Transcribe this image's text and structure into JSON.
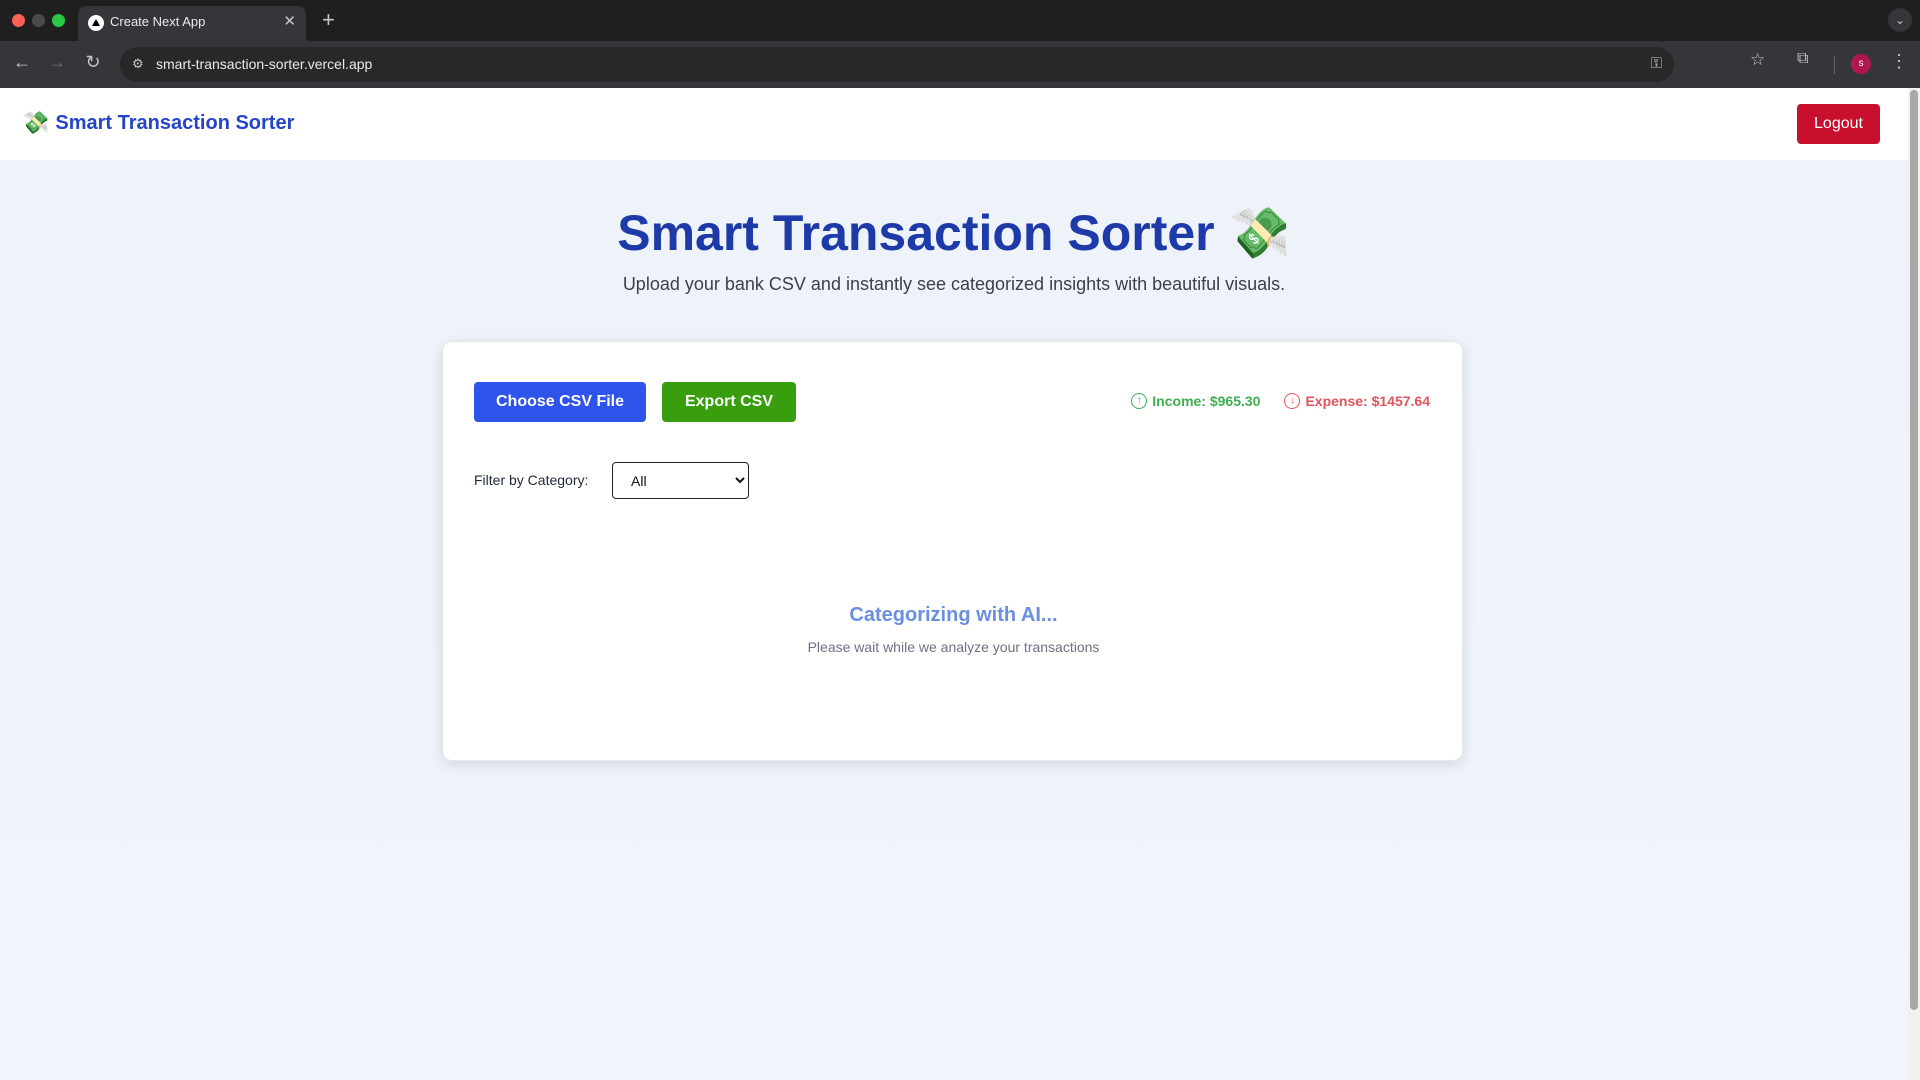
{
  "browser": {
    "tab_title": "Create Next App",
    "url": "smart-transaction-sorter.vercel.app",
    "avatar_initial": "s"
  },
  "navbar": {
    "brand_icon": "money-with-wings-icon",
    "brand_emoji": "💸",
    "brand_name": "Smart Transaction Sorter",
    "logout_label": "Logout"
  },
  "hero": {
    "title": "Smart Transaction Sorter 💸",
    "subtitle": "Upload your bank CSV and instantly see categorized insights with beautiful visuals."
  },
  "card": {
    "choose_label": "Choose CSV File",
    "export_label": "Export CSV",
    "income_label": "Income: $965.30",
    "expense_label": "Expense: $1457.64",
    "filter_label": "Filter by Category:",
    "filter_selected": "All",
    "loading_title": "Categorizing with AI...",
    "loading_sub": "Please wait while we analyze your transactions"
  },
  "colors": {
    "brand": "#2545c9",
    "primary_button": "#2f54eb",
    "export_button": "#389e0d",
    "logout_button": "#c8102e",
    "income": "#3fae4f",
    "expense": "#e0545b"
  }
}
